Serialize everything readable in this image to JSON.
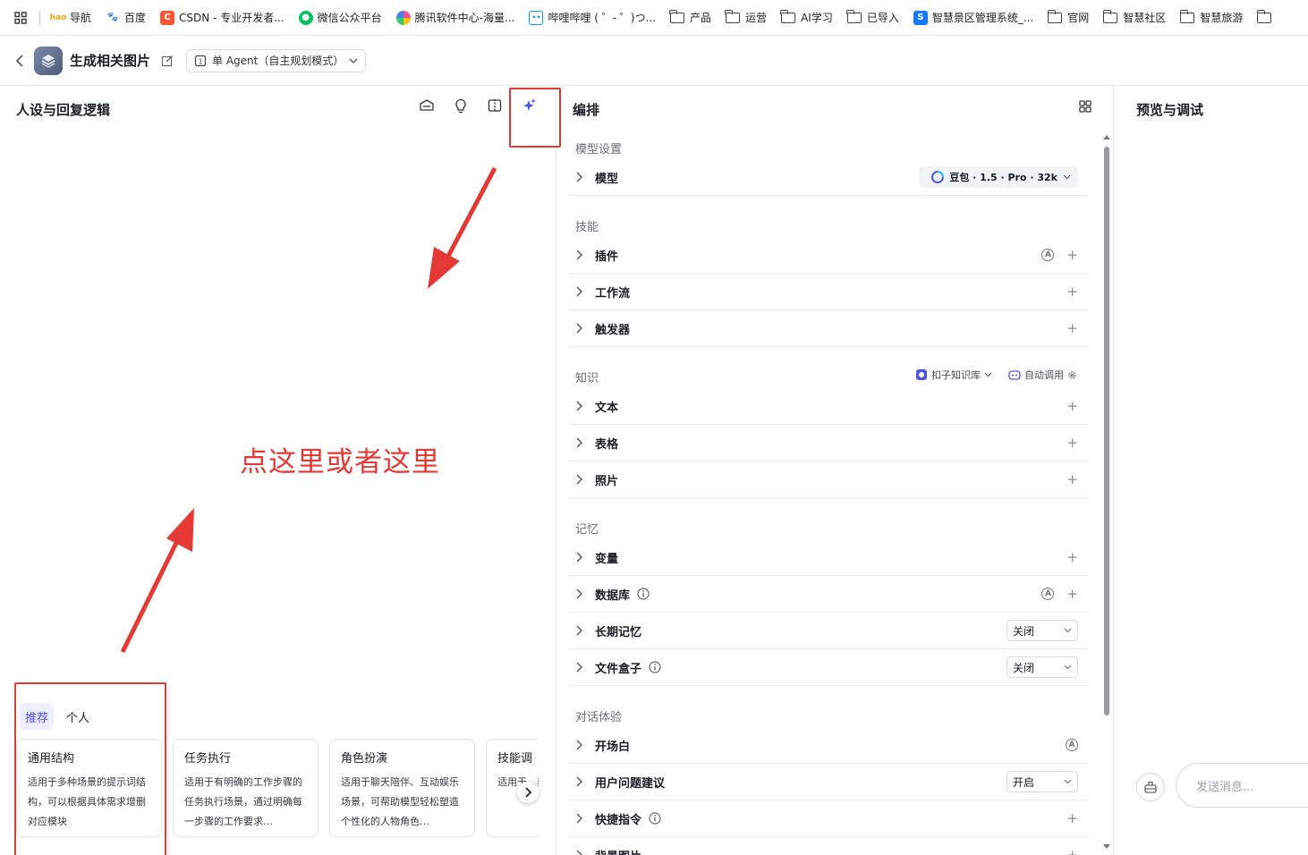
{
  "bookmarks": [
    {
      "label": "导航",
      "icon": "hao-icon",
      "color": "#e8a317"
    },
    {
      "label": "百度",
      "icon": "baidu-icon",
      "color": "#2932e1"
    },
    {
      "label": "CSDN - 专业开发者...",
      "icon": "csdn-icon",
      "color": "#fc5531"
    },
    {
      "label": "微信公众平台",
      "icon": "wechat-icon",
      "color": "#07c160"
    },
    {
      "label": "腾讯软件中心-海量...",
      "icon": "tencent-icon",
      "color": "#ff4b8b"
    },
    {
      "label": "哔哩哔哩 ( ゜- ゜)つ...",
      "icon": "bilibili-icon",
      "color": "#00a1d6"
    },
    {
      "label": "产品",
      "icon": "folder-icon"
    },
    {
      "label": "运营",
      "icon": "folder-icon"
    },
    {
      "label": "AI学习",
      "icon": "folder-icon"
    },
    {
      "label": "已导入",
      "icon": "folder-icon"
    },
    {
      "label": "智慧景区管理系统_...",
      "icon": "s-logo-icon",
      "color": "#1677ff"
    },
    {
      "label": "官网",
      "icon": "folder-icon"
    },
    {
      "label": "智慧社区",
      "icon": "folder-icon"
    },
    {
      "label": "智慧旅游",
      "icon": "folder-icon"
    }
  ],
  "header": {
    "app_title": "生成相关图片",
    "agent_mode": "单 Agent（自主规划模式）"
  },
  "left": {
    "title": "人设与回复逻辑",
    "annotation": "点这里或者这里",
    "tabs": [
      "推荐",
      "个人"
    ],
    "cards": [
      {
        "title": "通用结构",
        "desc": "适用于多种场景的提示词结构，可以根据具体需求增删对应模块"
      },
      {
        "title": "任务执行",
        "desc": "适用于有明确的工作步骤的任务执行场景，通过明确每一步骤的工作要求…"
      },
      {
        "title": "角色扮演",
        "desc": "适用于聊天陪伴、互动娱乐场景，可帮助模型轻松塑造个性化的人物角色…"
      },
      {
        "title": "技能调",
        "desc": "适用于…获取…的场景…"
      }
    ]
  },
  "mid": {
    "title": "编排",
    "sections": {
      "model": "模型设置",
      "skills": "技能",
      "knowledge": "知识",
      "memory": "记忆",
      "dialog": "对话体验"
    },
    "model_row": {
      "label": "模型",
      "value": "豆包 · 1.5 · Pro · 32k"
    },
    "skills_rows": [
      "插件",
      "工作流",
      "触发器"
    ],
    "knowledge_source": "扣子知识库",
    "knowledge_call": "自动调用",
    "knowledge_rows": [
      "文本",
      "表格",
      "照片"
    ],
    "memory_rows": {
      "variables": "变量",
      "database": "数据库",
      "long_memory": "长期记忆",
      "long_memory_value": "关闭",
      "file_box": "文件盒子",
      "file_box_value": "关闭"
    },
    "dialog_rows": {
      "opening": "开场白",
      "suggest": "用户问题建议",
      "suggest_value": "开启",
      "shortcut": "快捷指令",
      "background": "背景图片"
    }
  },
  "right": {
    "title": "预览与调试",
    "input_placeholder": "发送消息..."
  },
  "colors": {
    "accent": "#4d53e8",
    "annotation": "#e53935"
  }
}
